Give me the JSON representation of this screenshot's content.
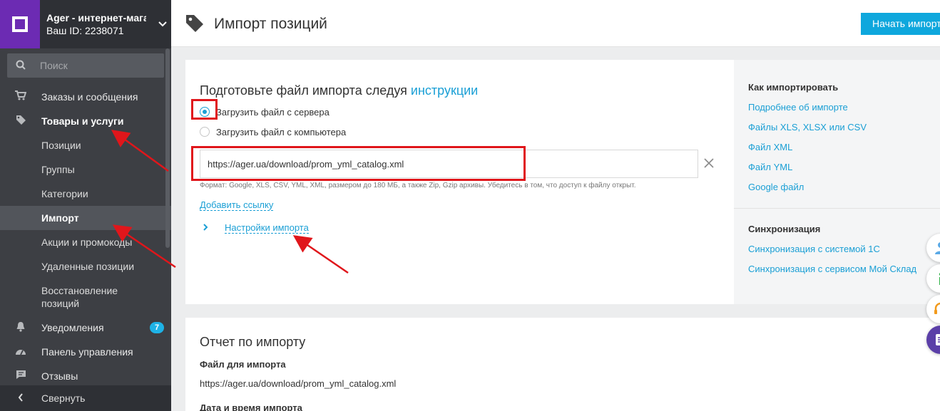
{
  "sidebar": {
    "store_name": "Ager - интернет-магаз...",
    "store_id": "Ваш ID: 2238071",
    "search_placeholder": "Поиск",
    "items": [
      {
        "label": "Заказы и сообщения",
        "icon": "cart-icon"
      },
      {
        "label": "Товары и услуги",
        "icon": "tag-icon"
      },
      {
        "label": "Позиции"
      },
      {
        "label": "Группы"
      },
      {
        "label": "Категории"
      },
      {
        "label": "Импорт"
      },
      {
        "label": "Акции и промокоды"
      },
      {
        "label": "Удаленные позиции"
      },
      {
        "label": "Восстановление позиций"
      },
      {
        "label": "Уведомления",
        "icon": "bell-icon",
        "badge": "7"
      },
      {
        "label": "Панель управления",
        "icon": "dashboard-icon"
      },
      {
        "label": "Отзывы",
        "icon": "comment-icon"
      }
    ],
    "collapse_label": "Свернуть"
  },
  "header": {
    "title": "Импорт позиций",
    "start_button": "Начать импорт"
  },
  "import_form": {
    "heading_prefix": "Подготовьте файл импорта следуя ",
    "heading_link": "инструкции",
    "radio_server": "Загрузить файл с сервера",
    "radio_computer": "Загрузить файл с компьютера",
    "url_value": "https://ager.ua/download/prom_yml_catalog.xml",
    "format_hint": "Формат: Google, XLS, CSV, YML, XML, размером до 180 МБ, а также Zip, Gzip архивы. Убедитесь в том, что доступ к файлу открыт.",
    "add_link": "Добавить ссылку",
    "settings_link": "Настройки импорта"
  },
  "help_panel": {
    "how_title": "Как импортировать",
    "how_links": [
      "Подробнее об импорте",
      "Файлы XLS, XLSX или CSV",
      "Файл XML",
      "Файл YML",
      "Google файл"
    ],
    "sync_title": "Синхронизация",
    "sync_links": [
      "Синхронизация с системой 1С",
      "Синхронизация с сервисом Мой Склад"
    ]
  },
  "report": {
    "title": "Отчет по импорту",
    "file_label": "Файл для импорта",
    "file_value": "https://ager.ua/download/prom_yml_catalog.xml",
    "date_label": "Дата и время импорта"
  },
  "colors": {
    "accent": "#0ea7dd",
    "link": "#1a9fd5",
    "sidebar_bg": "#3d3f44",
    "brand_purple": "#6c2bb3",
    "annotation_red": "#e0161b"
  }
}
